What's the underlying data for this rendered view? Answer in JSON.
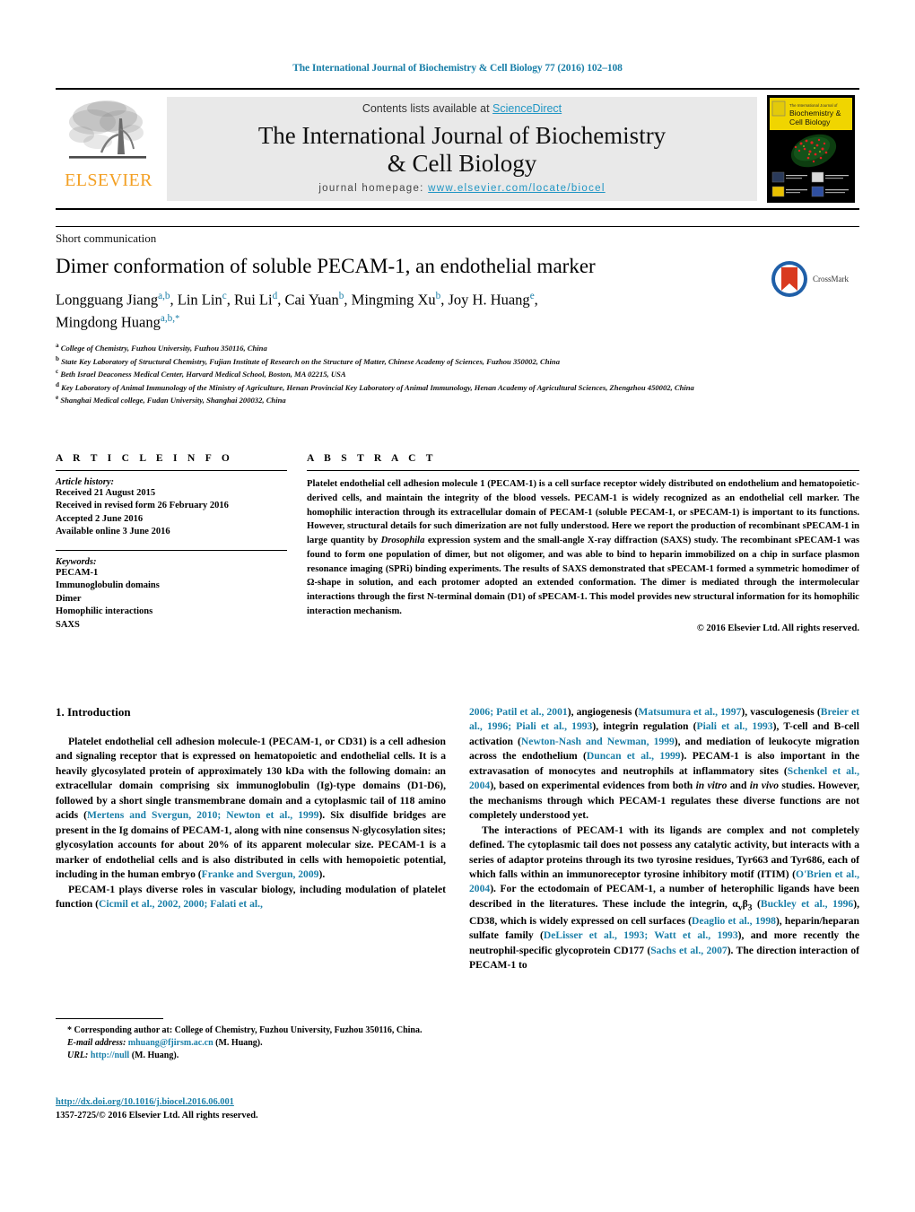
{
  "running_head": "The International Journal of Biochemistry & Cell Biology 77 (2016) 102–108",
  "masthead": {
    "publisher": "ELSEVIER",
    "contents_prefix": "Contents lists available at ",
    "contents_link": "ScienceDirect",
    "journal_title_line1": "The International Journal of Biochemistry",
    "journal_title_line2": "& Cell Biology",
    "homepage_prefix": "journal homepage: ",
    "homepage_url": "www.elsevier.com/locate/biocel",
    "cover_title_line1": "The International Journal of",
    "cover_title_line2": "Biochemistry &",
    "cover_title_line3": "Cell Biology"
  },
  "article": {
    "kicker": "Short communication",
    "title": "Dimer conformation of soluble PECAM-1, an endothelial marker",
    "crossmark_label": "CrossMark",
    "authors_line1": "Longguang Jiang",
    "authors": [
      {
        "name": "Longguang Jiang",
        "sup": "a,b"
      },
      {
        "name": "Lin Lin",
        "sup": "c"
      },
      {
        "name": "Rui Li",
        "sup": "d"
      },
      {
        "name": "Cai Yuan",
        "sup": "b"
      },
      {
        "name": "Mingming Xu",
        "sup": "b"
      },
      {
        "name": "Joy H. Huang",
        "sup": "e"
      },
      {
        "name": "Mingdong Huang",
        "sup": "a,b,*"
      }
    ],
    "affiliations": [
      {
        "mark": "a",
        "text": "College of Chemistry, Fuzhou University, Fuzhou 350116, China"
      },
      {
        "mark": "b",
        "text": "State Key Laboratory of Structural Chemistry, Fujian Institute of Research on the Structure of Matter, Chinese Academy of Sciences, Fuzhou 350002, China"
      },
      {
        "mark": "c",
        "text": "Beth Israel Deaconess Medical Center, Harvard Medical School, Boston, MA 02215, USA"
      },
      {
        "mark": "d",
        "text": "Key Laboratory of Animal Immunology of the Ministry of Agriculture, Henan Provincial Key Laboratory of Animal Immunology, Henan Academy of Agricultural Sciences, Zhengzhou 450002, China"
      },
      {
        "mark": "e",
        "text": "Shanghai Medical college, Fudan University, Shanghai 200032, China"
      }
    ]
  },
  "article_info": {
    "heading": "A R T I C L E   I N F O",
    "history_title": "Article history:",
    "history": [
      "Received 21 August 2015",
      "Received in revised form 26 February 2016",
      "Accepted 2 June 2016",
      "Available online 3 June 2016"
    ],
    "keywords_title": "Keywords:",
    "keywords": [
      "PECAM-1",
      "Immunoglobulin domains",
      "Dimer",
      "Homophilic interactions",
      "SAXS"
    ]
  },
  "abstract": {
    "heading": "A B S T R A C T",
    "paragraph_1": "Platelet endothelial cell adhesion molecule 1 (PECAM-1) is a cell surface receptor widely distributed on endothelium and hematopoietic-derived cells, and maintain the integrity of the blood vessels. PECAM-1 is widely recognized as an endothelial cell marker. The homophilic interaction through its extracellular domain of PECAM-1 (soluble PECAM-1, or sPECAM-1) is important to its functions. However, structural details for such dimerization are not fully understood. Here we report the production of recombinant sPECAM-1 in large quantity by ",
    "italic_1": "Drosophila",
    "paragraph_2": " expression system and the small-angle X-ray diffraction (SAXS) study. The recombinant sPECAM-1 was found to form one population of dimer, but not oligomer, and was able to bind to heparin immobilized on a chip in surface plasmon resonance imaging (SPRi) binding experiments. The results of SAXS demonstrated that sPECAM-1 formed a symmetric homodimer of Ω-shape in solution, and each protomer adopted an extended conformation. The dimer is mediated through the intermolecular interactions through the first N-terminal domain (D1) of sPECAM-1. This model provides new structural information for its homophilic interaction mechanism.",
    "copyright": "© 2016 Elsevier Ltd. All rights reserved."
  },
  "body": {
    "intro_heading": "1. Introduction",
    "left_p1_a": "Platelet endothelial cell adhesion molecule-1 (PECAM-1, or CD31) is a cell adhesion and signaling receptor that is expressed on hematopoietic and endothelial cells. It is a heavily glycosylated protein of approximately 130 kDa with the following domain: an extracellular domain comprising six immunoglobulin (Ig)-type domains (D1-D6), followed by a short single transmembrane domain and a cytoplasmic tail of 118 amino acids (",
    "left_p1_ref1": "Mertens and Svergun, 2010; Newton et al., 1999",
    "left_p1_b": "). Six disulfide bridges are present in the Ig domains of PECAM-1, along with nine consensus N-glycosylation sites; glycosylation accounts for about 20% of its apparent molecular size. PECAM-1 is a marker of endothelial cells and is also distributed in cells with hemopoietic potential, including in the human embryo (",
    "left_p1_ref2": "Franke and Svergun, 2009",
    "left_p1_c": ").",
    "left_p2_a": "PECAM-1 plays diverse roles in vascular biology, including modulation of platelet function (",
    "left_p2_ref1": "Cicmil et al., 2002, 2000; Falati et al.,",
    "right_p1_ref0": "2006; Patil et al., 2001",
    "right_p1_a": "), angiogenesis (",
    "right_p1_ref1": "Matsumura et al., 1997",
    "right_p1_b": "), vasculogenesis (",
    "right_p1_ref2": "Breier et al., 1996; Piali et al., 1993",
    "right_p1_c": "), integrin regulation (",
    "right_p1_ref3": "Piali et al., 1993",
    "right_p1_d": "), T-cell and B-cell activation (",
    "right_p1_ref4": "Newton-Nash and Newman, 1999",
    "right_p1_e": "), and mediation of leukocyte migration across the endothelium (",
    "right_p1_ref5": "Duncan et al., 1999",
    "right_p1_f": "). PECAM-1 is also important in the extravasation of monocytes and neutrophils at inflammatory sites (",
    "right_p1_ref6": "Schenkel et al., 2004",
    "right_p1_g": "), based on experimental evidences from both ",
    "right_p1_i1": "in vitro",
    "right_p1_h": " and ",
    "right_p1_i2": "in vivo",
    "right_p1_i": " studies. However, the mechanisms through which PECAM-1 regulates these diverse functions are not completely understood yet.",
    "right_p2_a": "The interactions of PECAM-1 with its ligands are complex and not completely defined. The cytoplasmic tail does not possess any catalytic activity, but interacts with a series of adaptor proteins through its two tyrosine residues, Tyr663 and Tyr686, each of which falls within an immunoreceptor tyrosine inhibitory motif (ITIM) (",
    "right_p2_ref1": "O'Brien et al., 2004",
    "right_p2_b": "). For the ectodomain of PECAM-1, a number of heterophilic ligands have been described in the literatures. These include the integrin, α",
    "right_p2_sub1": "v",
    "right_p2_c": "β",
    "right_p2_sub2": "3",
    "right_p2_d": " (",
    "right_p2_ref2": "Buckley et al., 1996",
    "right_p2_e": "), CD38, which is widely expressed on cell surfaces (",
    "right_p2_ref3": "Deaglio et al., 1998",
    "right_p2_f": "), heparin/heparan sulfate family (",
    "right_p2_ref4": "DeLisser et al., 1993; Watt et al., 1993",
    "right_p2_g": "), and more recently the neutrophil-specific glycoprotein CD177 (",
    "right_p2_ref5": "Sachs et al., 2007",
    "right_p2_h": "). The direction interaction of PECAM-1 to"
  },
  "footnotes": {
    "corresponding": "* Corresponding author at: College of Chemistry, Fuzhou University, Fuzhou 350116, China.",
    "email_label": "E-mail address:",
    "email": "mhuang@fjirsm.ac.cn",
    "email_suffix": " (M. Huang).",
    "url_label": "URL:",
    "url": "http://null",
    "url_suffix": " (M. Huang)."
  },
  "doi_block": {
    "doi": "http://dx.doi.org/10.1016/j.biocel.2016.06.001",
    "issn_line": "1357-2725/© 2016 Elsevier Ltd. All rights reserved."
  },
  "colors": {
    "link": "#1a7fa8",
    "sciencedirect": "#2196c4",
    "elsevier_orange": "#f3a024",
    "cover_yellow": "#f0d500"
  }
}
